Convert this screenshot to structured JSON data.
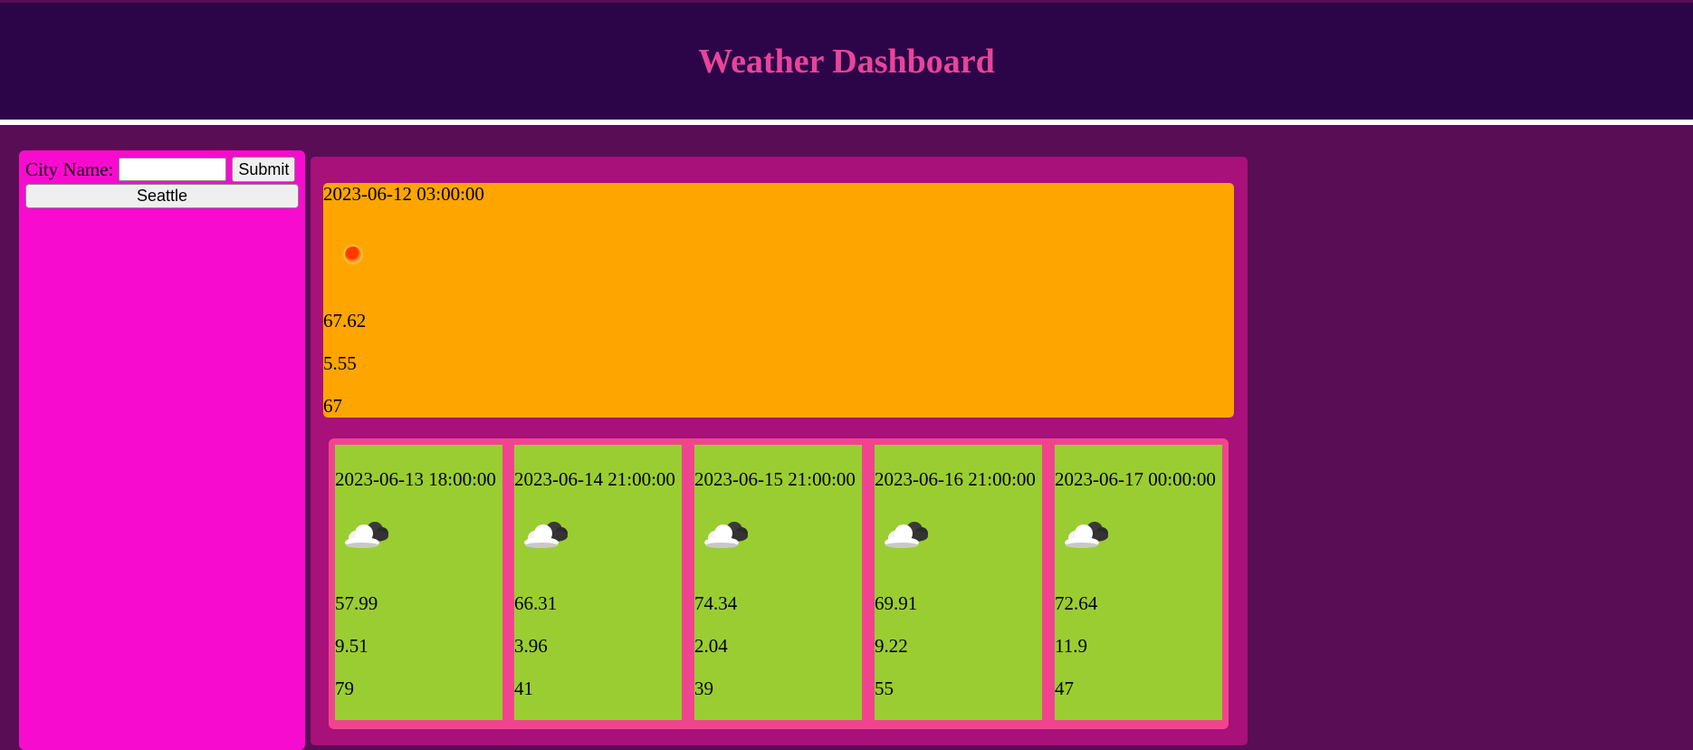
{
  "header": {
    "title": "Weather Dashboard"
  },
  "sidebar": {
    "city_label": "City Name:",
    "city_input_value": "",
    "submit_label": "Submit",
    "history": [
      "Seattle"
    ]
  },
  "current": {
    "date": "2023-06-12 03:00:00",
    "icon": "sun-icon",
    "temp": "67.62",
    "wind": "5.55",
    "humidity": "67"
  },
  "forecast": [
    {
      "date": "2023-06-13 18:00:00",
      "icon": "cloud-icon",
      "temp": "57.99",
      "wind": "9.51",
      "humidity": "79"
    },
    {
      "date": "2023-06-14 21:00:00",
      "icon": "cloud-icon",
      "temp": "66.31",
      "wind": "3.96",
      "humidity": "41"
    },
    {
      "date": "2023-06-15 21:00:00",
      "icon": "cloud-icon",
      "temp": "74.34",
      "wind": "2.04",
      "humidity": "39"
    },
    {
      "date": "2023-06-16 21:00:00",
      "icon": "cloud-icon",
      "temp": "69.91",
      "wind": "9.22",
      "humidity": "55"
    },
    {
      "date": "2023-06-17 00:00:00",
      "icon": "cloud-icon",
      "temp": "72.64",
      "wind": "11.9",
      "humidity": "47"
    }
  ],
  "colors": {
    "background": "#580d55",
    "header_bg": "#2c0548",
    "title": "#e8449a",
    "sidebar": "#f70ccf",
    "main_panel": "#a8107a",
    "current_card": "#ffa500",
    "forecast_wrap": "#f0458e",
    "forecast_card": "#9acd32"
  }
}
